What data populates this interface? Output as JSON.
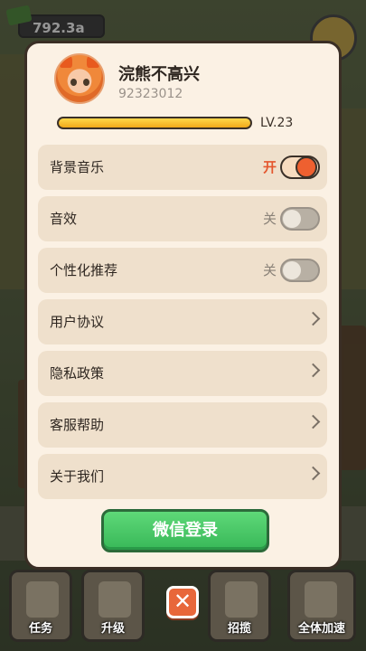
{
  "hud": {
    "coins": "792.3a"
  },
  "profile": {
    "name": "浣熊不高兴",
    "id": "92323012",
    "level": "LV.23",
    "xp_progress": 1.0
  },
  "settings": [
    {
      "label": "背景音乐",
      "state": "开",
      "type": "toggle",
      "on": true
    },
    {
      "label": "音效",
      "state": "关",
      "type": "toggle",
      "on": false
    },
    {
      "label": "个性化推荐",
      "state": "关",
      "type": "toggle",
      "on": false
    },
    {
      "label": "用户协议",
      "type": "link"
    },
    {
      "label": "隐私政策",
      "type": "link"
    },
    {
      "label": "客服帮助",
      "type": "link"
    },
    {
      "label": "关于我们",
      "type": "link"
    }
  ],
  "login_button": "微信登录",
  "close_icon": "✕",
  "bottom_bar": [
    {
      "label": "任务",
      "icon": "task-clipboard-icon"
    },
    {
      "label": "升级",
      "icon": "hammer-icon"
    },
    {
      "label": "招揽",
      "icon": "megaphone-icon"
    },
    {
      "label": "全体加速",
      "icon": "speed-up-icon"
    }
  ],
  "colors": {
    "accent": "#e4572e",
    "login_green": "#45c464",
    "panel": "#fbf1e4"
  }
}
